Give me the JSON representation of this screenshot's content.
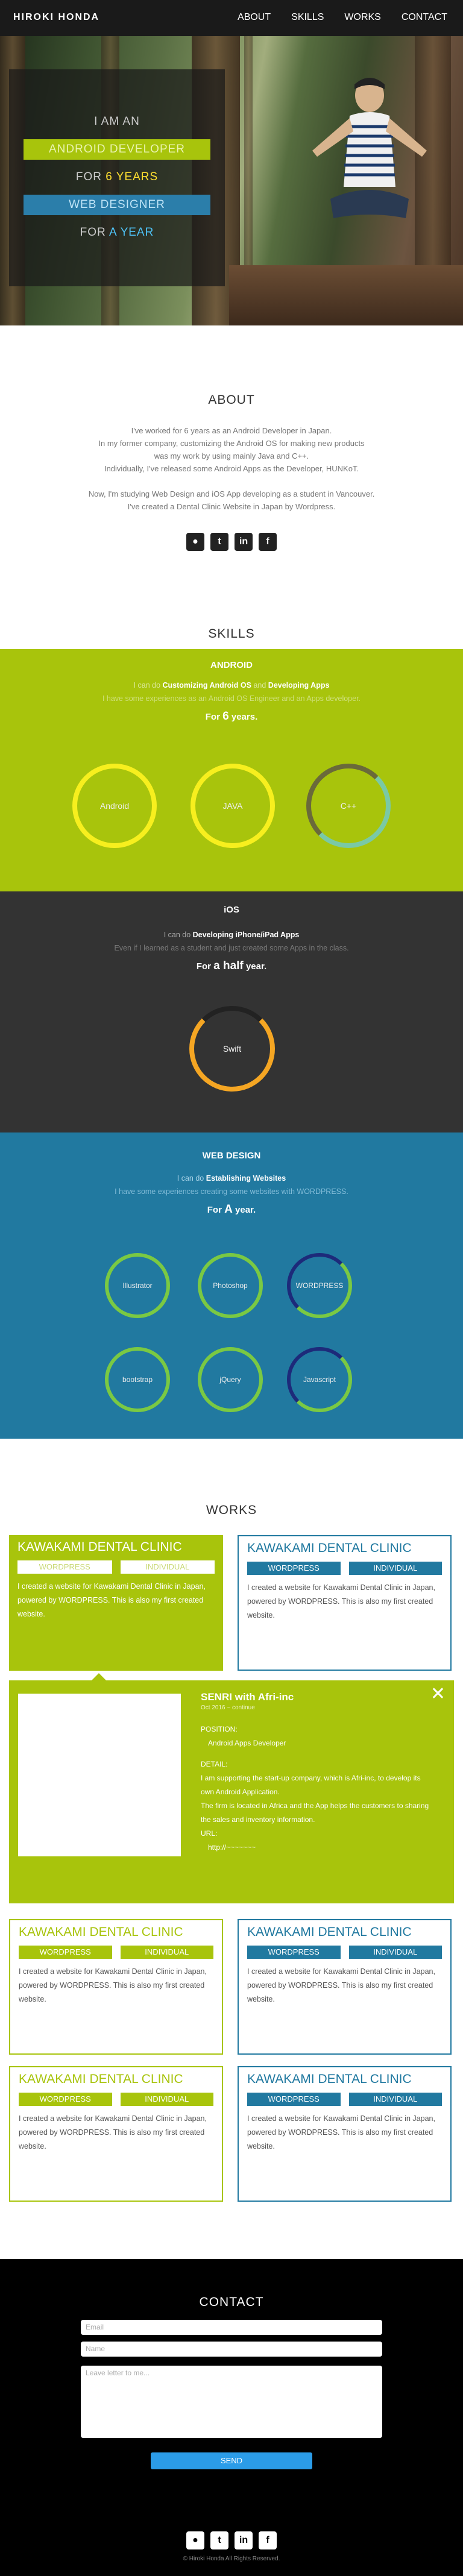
{
  "header": {
    "brand": "HIROKI HONDA",
    "nav": [
      "ABOUT",
      "SKILLS",
      "WORKS",
      "CONTACT"
    ]
  },
  "hero": {
    "line1": "I AM AN",
    "line2": "ANDROID DEVELOPER",
    "line3a": "FOR",
    "line3b": "6 YEARS",
    "line4": "WEB DESIGNER",
    "line5a": "FOR",
    "line5b": "A YEAR"
  },
  "about": {
    "title": "ABOUT",
    "p1": [
      "I've worked for 6 years as an Android Developer in Japan.",
      "In my former company, customizing the Android OS for making new products",
      "was my work by using mainly Java and C++.",
      "Individually, I've released some Android Apps as the Developer, HUNKoT."
    ],
    "p2": [
      "Now, I'm studying Web Design and iOS App developing as a student in Vancouver.",
      "I've created a Dental Clinic Website in Japan by Wordpress."
    ]
  },
  "social": {
    "icons": [
      "github-icon",
      "twitter-icon",
      "linkedin-icon",
      "facebook-icon"
    ],
    "glyphs": [
      "●",
      "t",
      "in",
      "f"
    ]
  },
  "skills": {
    "title": "SKILLS",
    "android": {
      "title": "ANDROID",
      "sub1a": "I can do",
      "sub1b": "Customizing Android OS",
      "sub1c": "and",
      "sub1d": "Developing Apps",
      "sub2": "I have some experiences as an Android OS Engineer and an Apps developer.",
      "forA": "For",
      "forB": "6",
      "forC": "years.",
      "circles": [
        "Android",
        "JAVA",
        "C++"
      ]
    },
    "ios": {
      "title": "iOS",
      "sub1a": "I can do",
      "sub1b": "Developing iPhone/iPad Apps",
      "sub2": "Even if I learned as a student and just created some Apps in the class.",
      "forA": "For",
      "forB": "a half",
      "forC": "year.",
      "circles": [
        "Swift"
      ]
    },
    "web": {
      "title": "WEB DESIGN",
      "sub1a": "I can do",
      "sub1b": "Establishing Websites",
      "sub2": "I have some experiences creating some websites with WORDPRESS.",
      "forA": "For",
      "forB": "A",
      "forC": "year.",
      "circles": [
        "Illustrator",
        "Photoshop",
        "WORDPRESS",
        "bootstrap",
        "jQuery",
        "Javascript"
      ]
    }
  },
  "works": {
    "title": "WORKS",
    "card_title": "KAWAKAMI DENTAL CLINIC",
    "tag1": "WORDPRESS",
    "tag2": "INDIVIDUAL",
    "text": "I created a website for Kawakami Dental Clinic in Japan, powered by WORDPRESS. This is also my first created website.",
    "detail": {
      "title": "SENRI with Afri-inc",
      "date": "Oct 2016 ~ continue",
      "position_label": "POSITION:",
      "position": "Android Apps Developer",
      "detail_label": "DETAIL:",
      "detail": [
        "I am supporting the start-up company, which is Afri-inc, to develop its",
        "own Android Application.",
        "The firm is located in Africa and the App helps the customers to sharing",
        "the sales and inventory information."
      ],
      "url_label": "URL:",
      "url": "http://~~~~~~~"
    }
  },
  "contact": {
    "title": "CONTACT",
    "email": "Email",
    "name": "Name",
    "message": "Leave letter to me...",
    "send": "SEND",
    "copyright": "© Hiroki Honda All Rights Reserved."
  },
  "colors": {
    "green": "#a8c40c",
    "dark": "#333333",
    "blue": "#2179a0",
    "circle_ring": "#f7ef1e",
    "swift_ring": "#f5a623",
    "web_ring": "#7ac943",
    "web_arc": "#1d2a7a"
  }
}
